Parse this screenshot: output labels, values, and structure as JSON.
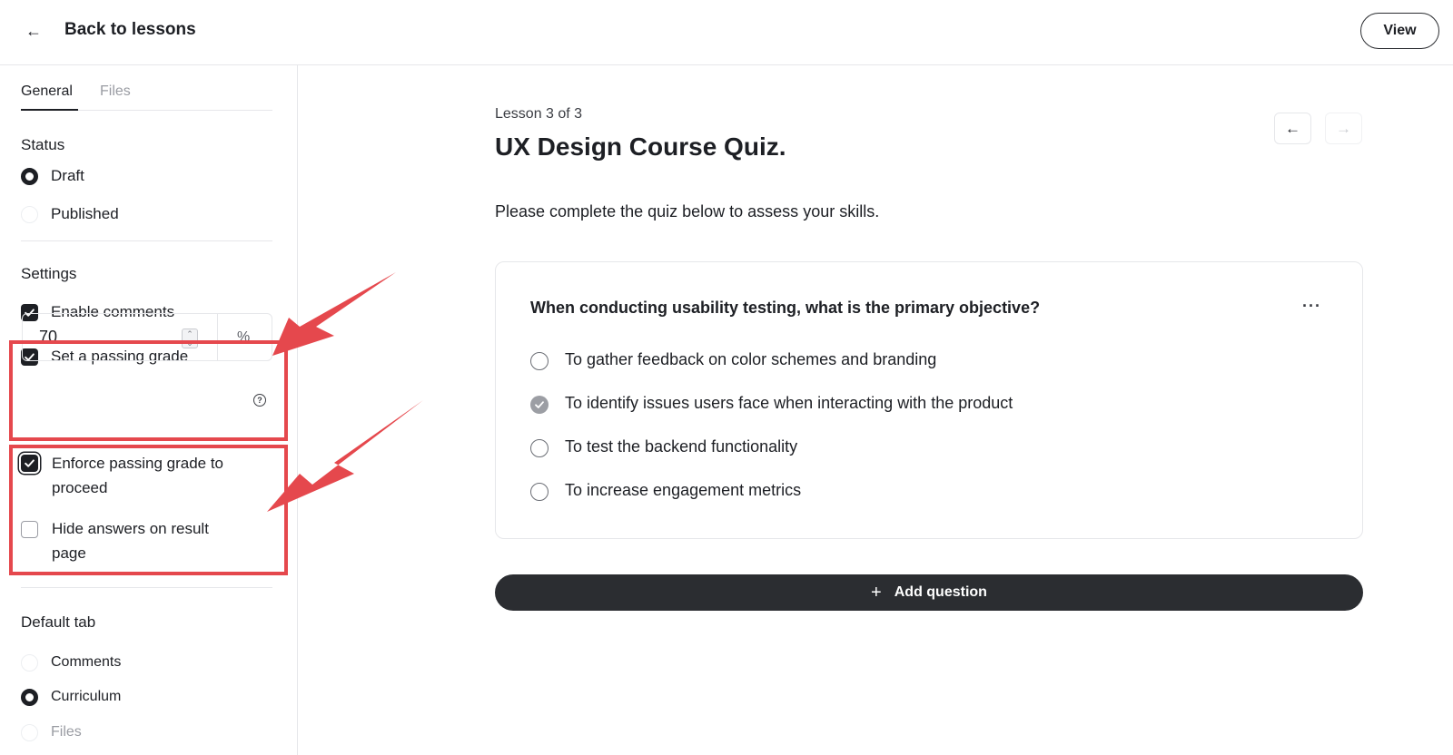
{
  "header": {
    "back_label": "Back to lessons",
    "view_label": "View"
  },
  "sidebar": {
    "tabs": [
      {
        "label": "General",
        "active": true
      },
      {
        "label": "Files",
        "active": false
      }
    ],
    "status": {
      "title": "Status",
      "options": [
        {
          "label": "Draft",
          "selected": true
        },
        {
          "label": "Published",
          "selected": false
        }
      ]
    },
    "settings": {
      "title": "Settings",
      "enable_comments": {
        "label": "Enable comments",
        "checked": true
      },
      "passing_grade": {
        "label": "Set a passing grade",
        "checked": true,
        "value": "70",
        "unit": "%"
      },
      "enforce": {
        "label_line1": "Enforce passing grade to",
        "label_line2": "proceed",
        "checked": true
      },
      "hide_answers": {
        "label_line1": "Hide answers on result",
        "label_line2": "page",
        "checked": false
      }
    },
    "default_tab": {
      "title": "Default tab",
      "options": [
        {
          "label": "Comments",
          "selected": false
        },
        {
          "label": "Curriculum",
          "selected": true
        },
        {
          "label": "Files",
          "selected": false
        }
      ]
    }
  },
  "main": {
    "lesson_count": "Lesson 3 of 3",
    "title": "UX Design Course Quiz.",
    "intro": "Please complete the quiz below to assess your skills.",
    "question": {
      "text": "When conducting usability testing, what is the primary objective?",
      "more": "···",
      "answers": [
        {
          "label": "To gather feedback on color schemes and branding",
          "correct": false
        },
        {
          "label": "To identify issues users face when interacting with the product",
          "correct": true
        },
        {
          "label": "To test the backend functionality",
          "correct": false
        },
        {
          "label": "To increase engagement metrics",
          "correct": false
        }
      ]
    },
    "add_question_label": "Add question"
  },
  "colors": {
    "accent_dark": "#1d1f24",
    "annotation_red": "#e5484d",
    "border": "#e6e7ea"
  }
}
